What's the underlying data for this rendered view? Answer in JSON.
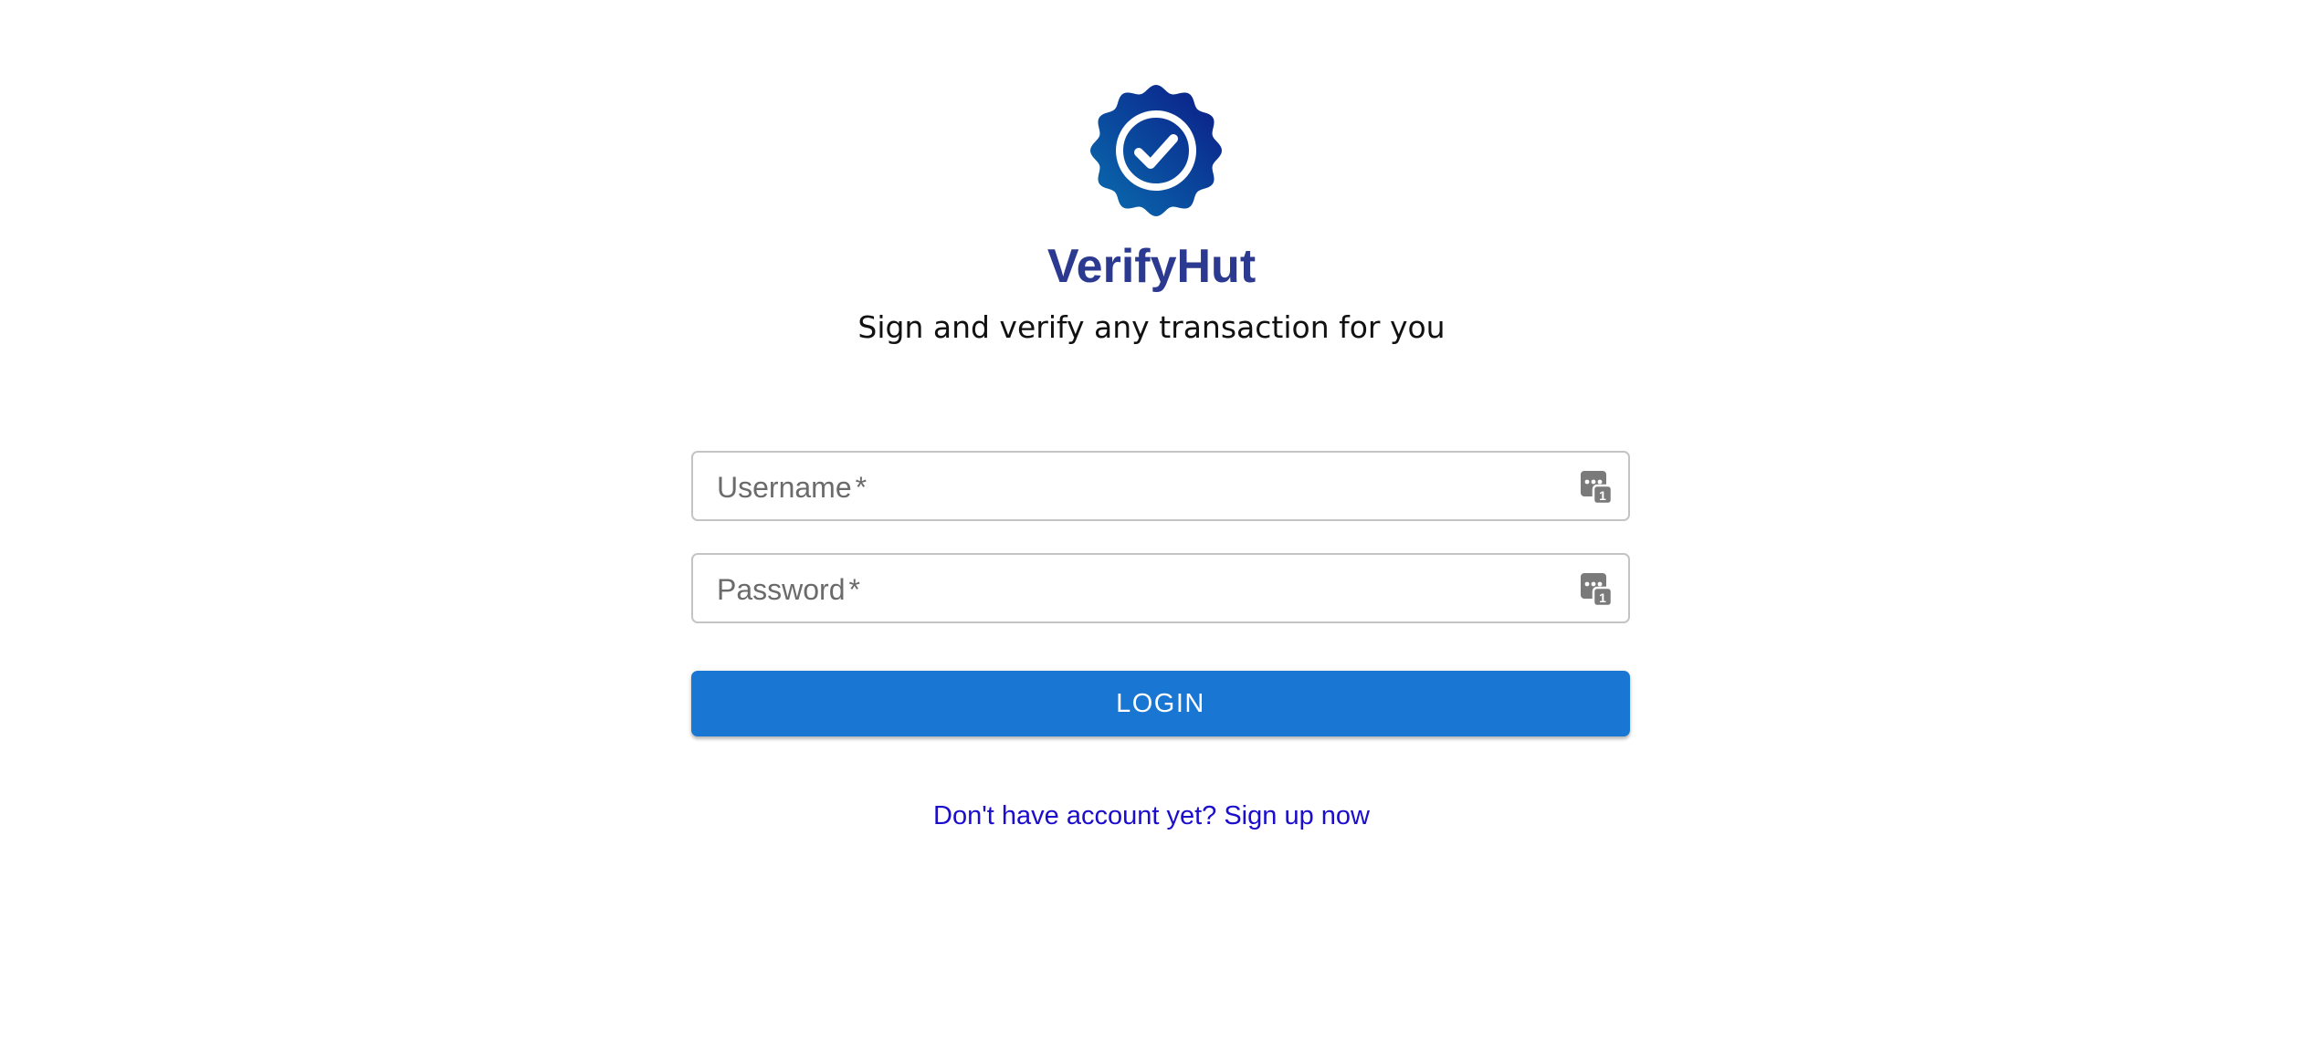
{
  "brand": {
    "name": "VerifyHut",
    "tagline": "Sign and verify any transaction for you",
    "logo_icon": "verified-badge-icon",
    "colors": {
      "title": "#2b3990",
      "badge_gradient_start": "#0a5fa8",
      "badge_gradient_end": "#0b1f8c"
    }
  },
  "login_form": {
    "username": {
      "label": "Username",
      "required_mark": "*",
      "value": "",
      "autofill_icon": "password-manager-icon"
    },
    "password": {
      "label": "Password",
      "required_mark": "*",
      "value": "",
      "autofill_icon": "password-manager-icon"
    },
    "submit_label": "LOGIN",
    "submit_color": "#1976d2"
  },
  "signup": {
    "link_text": "Don't have account yet? Sign up now",
    "link_color": "#1a0dcc"
  }
}
